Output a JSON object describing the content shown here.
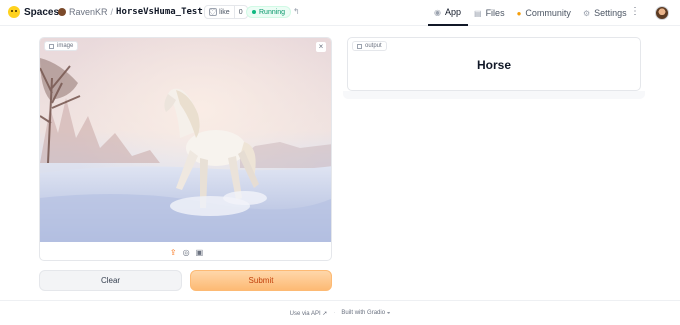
{
  "header": {
    "brand": "Spaces",
    "owner": "RavenKR",
    "separator": "/",
    "space_name": "HorseVsHuma_Test",
    "like_label": "like",
    "like_count": "0",
    "status": "Running",
    "nav": [
      {
        "label": "App",
        "icon": "app-icon"
      },
      {
        "label": "Files",
        "icon": "files-icon"
      },
      {
        "label": "Community",
        "icon": "community-icon"
      },
      {
        "label": "Settings",
        "icon": "gear-icon"
      }
    ]
  },
  "input": {
    "label": "image"
  },
  "output": {
    "label": "output",
    "value": "Horse"
  },
  "buttons": {
    "clear": "Clear",
    "submit": "Submit"
  },
  "footer": {
    "api": "Use via API",
    "built": "Built with Gradio"
  },
  "colors": {
    "accent": "#f97316",
    "status": "#10b981"
  }
}
